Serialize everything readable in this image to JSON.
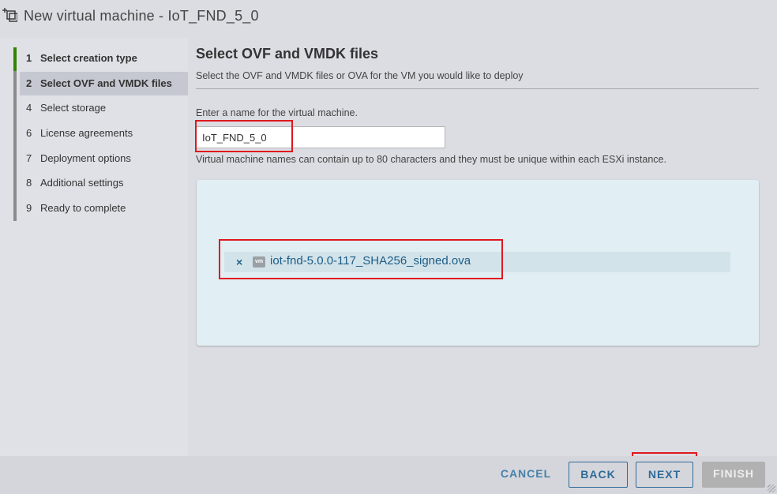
{
  "window": {
    "title": "New virtual machine - IoT_FND_5_0",
    "icon": "new-vm-icon"
  },
  "sidebar": {
    "steps": [
      {
        "number": "1",
        "label": "Select creation type",
        "state": "done"
      },
      {
        "number": "2",
        "label": "Select OVF and VMDK files",
        "state": "active"
      },
      {
        "number": "4",
        "label": "Select storage",
        "state": "pending"
      },
      {
        "number": "6",
        "label": "License agreements",
        "state": "pending"
      },
      {
        "number": "7",
        "label": "Deployment options",
        "state": "pending"
      },
      {
        "number": "8",
        "label": "Additional settings",
        "state": "pending"
      },
      {
        "number": "9",
        "label": "Ready to complete",
        "state": "pending"
      }
    ]
  },
  "main": {
    "title": "Select OVF and VMDK files",
    "subtitle": "Select the OVF and VMDK files or OVA for the VM you would like to deploy",
    "name_label": "Enter a name for the virtual machine.",
    "name_value": "IoT_FND_5_0",
    "name_help": "Virtual machine names can contain up to 80 characters and they must be unique within each ESXi instance.",
    "files": [
      {
        "remove_glyph": "×",
        "icon": "vm-file-icon",
        "icon_text": "vm",
        "name": "iot-fnd-5.0.0-117_SHA256_signed.ova"
      }
    ]
  },
  "footer": {
    "cancel": "CANCEL",
    "back": "BACK",
    "next": "NEXT",
    "finish": "FINISH"
  },
  "colors": {
    "active_step_marker": "#2f8400",
    "link_blue": "#1c5d86",
    "highlight_red": "#e0171f",
    "dropzone_bg": "#e1eff4"
  }
}
